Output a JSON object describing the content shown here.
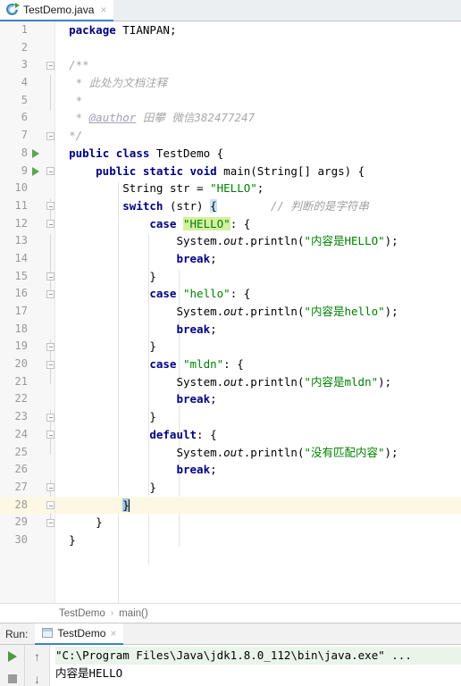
{
  "tab": {
    "label": "TestDemo.java",
    "icon": "java-class-icon",
    "close": "×"
  },
  "editor": {
    "lines": [
      {
        "n": "1",
        "runmark": false,
        "fold": "",
        "indent": 0
      },
      {
        "n": "2",
        "runmark": false,
        "fold": "",
        "indent": 0
      },
      {
        "n": "3",
        "runmark": false,
        "fold": "open",
        "indent": 0
      },
      {
        "n": "4",
        "runmark": false,
        "fold": "",
        "indent": 0
      },
      {
        "n": "5",
        "runmark": false,
        "fold": "",
        "indent": 0
      },
      {
        "n": "6",
        "runmark": false,
        "fold": "",
        "indent": 0
      },
      {
        "n": "7",
        "runmark": false,
        "fold": "close",
        "indent": 0
      },
      {
        "n": "8",
        "runmark": true,
        "fold": "",
        "indent": 0
      },
      {
        "n": "9",
        "runmark": true,
        "fold": "open",
        "indent": 0
      },
      {
        "n": "10",
        "runmark": false,
        "fold": "",
        "indent": 0
      },
      {
        "n": "11",
        "runmark": false,
        "fold": "open",
        "indent": 0
      },
      {
        "n": "12",
        "runmark": false,
        "fold": "open",
        "indent": 0
      },
      {
        "n": "13",
        "runmark": false,
        "fold": "",
        "indent": 0
      },
      {
        "n": "14",
        "runmark": false,
        "fold": "",
        "indent": 0
      },
      {
        "n": "15",
        "runmark": false,
        "fold": "close",
        "indent": 0
      },
      {
        "n": "16",
        "runmark": false,
        "fold": "open",
        "indent": 0
      },
      {
        "n": "17",
        "runmark": false,
        "fold": "",
        "indent": 0
      },
      {
        "n": "18",
        "runmark": false,
        "fold": "",
        "indent": 0
      },
      {
        "n": "19",
        "runmark": false,
        "fold": "close",
        "indent": 0
      },
      {
        "n": "20",
        "runmark": false,
        "fold": "open",
        "indent": 0
      },
      {
        "n": "21",
        "runmark": false,
        "fold": "",
        "indent": 0
      },
      {
        "n": "22",
        "runmark": false,
        "fold": "",
        "indent": 0
      },
      {
        "n": "23",
        "runmark": false,
        "fold": "close",
        "indent": 0
      },
      {
        "n": "24",
        "runmark": false,
        "fold": "open",
        "indent": 0
      },
      {
        "n": "25",
        "runmark": false,
        "fold": "",
        "indent": 0
      },
      {
        "n": "26",
        "runmark": false,
        "fold": "",
        "indent": 0
      },
      {
        "n": "27",
        "runmark": false,
        "fold": "close",
        "indent": 0
      },
      {
        "n": "28",
        "runmark": false,
        "fold": "close",
        "indent": 0
      },
      {
        "n": "29",
        "runmark": false,
        "fold": "close",
        "indent": 0
      },
      {
        "n": "30",
        "runmark": false,
        "fold": "",
        "indent": 0
      }
    ],
    "current_line": 28,
    "code": {
      "l1_kw": "package",
      "l1_rest": " TIANPAN;",
      "l3": "/**",
      "l4": "* 此处为文档注释",
      "l5": "*",
      "l6_star": "* ",
      "l6_tag": "@author",
      "l6_rest": " 田攀 微信382477247",
      "l7": "*/",
      "l8_kw1": "public",
      "l8_kw2": "class",
      "l8_name": " TestDemo {",
      "l9_kw1": "public",
      "l9_kw2": "static",
      "l9_kw3": "void",
      "l9_rest": " main(String[] args) {",
      "l10_type": "String",
      "l10_mid": " str = ",
      "l10_str": "\"HELLO\"",
      "l10_end": ";",
      "l11_kw": "switch",
      "l11_mid": " (str) ",
      "l11_brace": "{",
      "l11_comment": "// 判断的是字符串",
      "l12_kw": "case",
      "l12_str": "\"HELLO\"",
      "l12_end": ": {",
      "l13_pre": "System.",
      "l13_field": "out",
      "l13_mid": ".println(",
      "l13_str": "\"内容是HELLO\"",
      "l13_end": ");",
      "l14_kw": "break",
      "l14_end": ";",
      "l15": "}",
      "l16_kw": "case",
      "l16_str": "\"hello\"",
      "l16_end": ": {",
      "l17_str": "\"内容是hello\"",
      "l20_kw": "case",
      "l20_str": "\"mldn\"",
      "l20_end": ": {",
      "l21_str": "\"内容是mldn\"",
      "l24_kw": "default",
      "l24_end": ": {",
      "l25_str": "\"没有匹配内容\"",
      "l28_brace": "}",
      "l29_brace": "}",
      "l30_brace": "}"
    }
  },
  "breadcrumb": {
    "items": [
      "TestDemo",
      "main()"
    ],
    "separator": "›"
  },
  "run_panel": {
    "run_label": "Run:",
    "tab_label": "TestDemo",
    "tab_close": "×",
    "toolbar": {
      "rerun": "rerun-icon",
      "stop": "stop-icon",
      "up": "↑",
      "down": "↓"
    },
    "console": {
      "command": "\"C:\\Program Files\\Java\\jdk1.8.0_112\\bin\\java.exe\" ...",
      "output": "内容是HELLO"
    }
  }
}
